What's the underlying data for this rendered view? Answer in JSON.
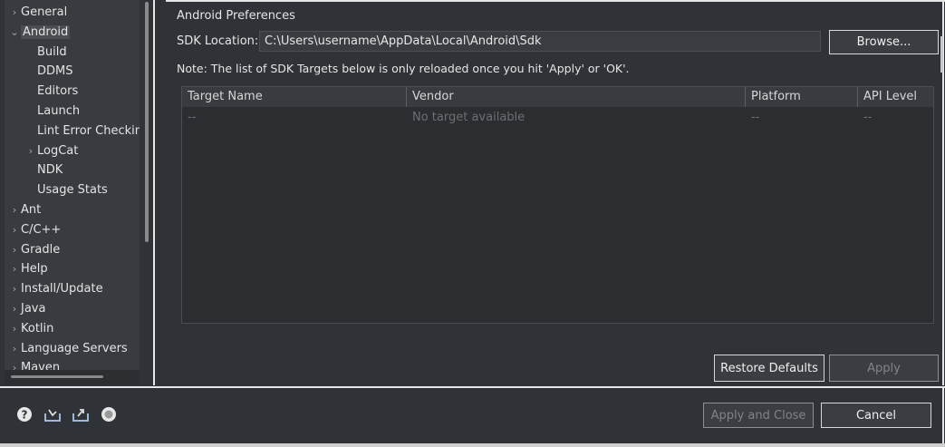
{
  "tree": {
    "items": [
      {
        "label": "General",
        "expander": "›",
        "indent": 0
      },
      {
        "label": "Android",
        "expander": "⌄",
        "indent": 0,
        "selected": true
      },
      {
        "label": "Build",
        "expander": "",
        "indent": 1
      },
      {
        "label": "DDMS",
        "expander": "",
        "indent": 1
      },
      {
        "label": "Editors",
        "expander": "",
        "indent": 1
      },
      {
        "label": "Launch",
        "expander": "",
        "indent": 1
      },
      {
        "label": "Lint Error Checking",
        "expander": "",
        "indent": 1
      },
      {
        "label": "LogCat",
        "expander": "›",
        "indent": 1
      },
      {
        "label": "NDK",
        "expander": "",
        "indent": 1
      },
      {
        "label": "Usage Stats",
        "expander": "",
        "indent": 1
      },
      {
        "label": "Ant",
        "expander": "›",
        "indent": 0
      },
      {
        "label": "C/C++",
        "expander": "›",
        "indent": 0
      },
      {
        "label": "Gradle",
        "expander": "›",
        "indent": 0
      },
      {
        "label": "Help",
        "expander": "›",
        "indent": 0
      },
      {
        "label": "Install/Update",
        "expander": "›",
        "indent": 0
      },
      {
        "label": "Java",
        "expander": "›",
        "indent": 0
      },
      {
        "label": "Kotlin",
        "expander": "›",
        "indent": 0
      },
      {
        "label": "Language Servers",
        "expander": "›",
        "indent": 0
      },
      {
        "label": "Maven",
        "expander": "›",
        "indent": 0
      }
    ]
  },
  "page": {
    "title": "Android Preferences",
    "sdk_label": "SDK Location:",
    "sdk_value": "C:\\Users\\username\\AppData\\Local\\Android\\Sdk",
    "browse_label": "Browse...",
    "note": "Note: The list of SDK Targets below is only reloaded once you hit 'Apply' or 'OK'."
  },
  "table": {
    "columns": [
      "Target Name",
      "Vendor",
      "Platform",
      "API Level"
    ],
    "rows": [
      [
        "--",
        "No target available",
        "--",
        "--"
      ]
    ]
  },
  "buttons": {
    "restore_defaults": "Restore Defaults",
    "apply": "Apply",
    "apply_and_close": "Apply and Close",
    "cancel": "Cancel"
  },
  "footer_icons": [
    "help-icon",
    "import-icon",
    "export-icon",
    "record-icon"
  ],
  "colors": {
    "background": "#2f3236",
    "tree_background": "#383b3f",
    "border": "#e7e7e7",
    "disabled_text": "#80838a"
  }
}
